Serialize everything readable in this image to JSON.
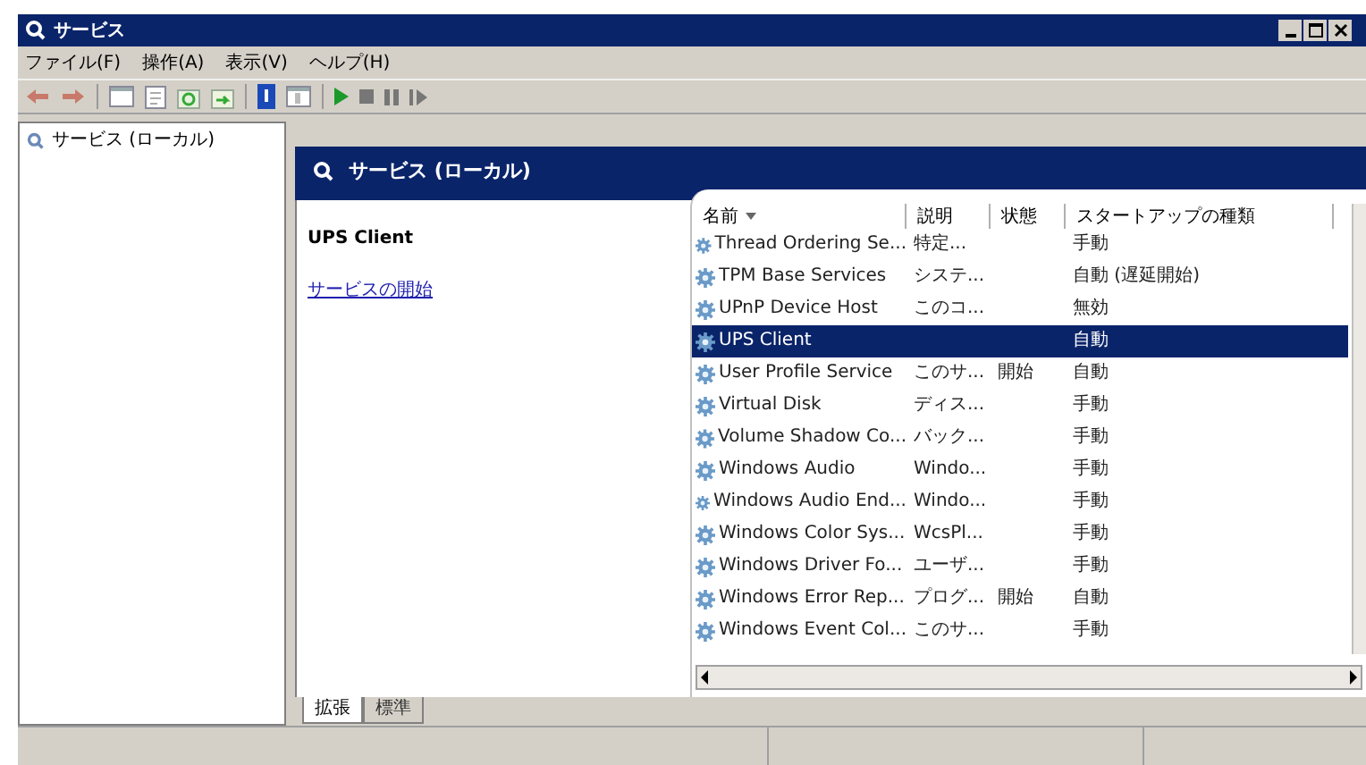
{
  "window": {
    "title": "サービス"
  },
  "menu": [
    "ファイル(F)",
    "操作(A)",
    "表示(V)",
    "ヘルプ(H)"
  ],
  "tree": {
    "items": [
      {
        "label": "サービス (ローカル)",
        "selected": false
      }
    ]
  },
  "panel": {
    "header": "サービス (ローカル)",
    "service_name": "UPS Client",
    "link": "サービスの開始"
  },
  "table": {
    "columns": [
      "名前",
      "説明",
      "状態",
      "スタートアップの種類"
    ],
    "rows": [
      {
        "name": "Thread Ordering Se...",
        "description": "特定...",
        "status": "",
        "startup": "手動",
        "selected": false
      },
      {
        "name": "TPM Base Services",
        "description": "システ...",
        "status": "",
        "startup": "自動 (遅延開始)",
        "selected": false
      },
      {
        "name": "UPnP Device Host",
        "description": "このコ...",
        "status": "",
        "startup": "無効",
        "selected": false
      },
      {
        "name": "UPS Client",
        "description": "",
        "status": "",
        "startup": "自動",
        "selected": true
      },
      {
        "name": "User Profile Service",
        "description": "このサ...",
        "status": "開始",
        "startup": "自動",
        "selected": false
      },
      {
        "name": "Virtual Disk",
        "description": "ディス...",
        "status": "",
        "startup": "手動",
        "selected": false
      },
      {
        "name": "Volume Shadow Co...",
        "description": "バック...",
        "status": "",
        "startup": "手動",
        "selected": false
      },
      {
        "name": "Windows Audio",
        "description": "Windo...",
        "status": "",
        "startup": "手動",
        "selected": false
      },
      {
        "name": "Windows Audio End...",
        "description": "Windo...",
        "status": "",
        "startup": "手動",
        "selected": false
      },
      {
        "name": "Windows Color Sys...",
        "description": "WcsPl...",
        "status": "",
        "startup": "手動",
        "selected": false
      },
      {
        "name": "Windows Driver Fo...",
        "description": "ユーザ...",
        "status": "",
        "startup": "手動",
        "selected": false
      },
      {
        "name": "Windows Error Rep...",
        "description": "プログ...",
        "status": "開始",
        "startup": "自動",
        "selected": false
      },
      {
        "name": "Windows Event Col...",
        "description": "このサ...",
        "status": "",
        "startup": "手動",
        "selected": false
      }
    ]
  },
  "tabs": [
    {
      "label": "拡張",
      "selected": true
    },
    {
      "label": "標準",
      "selected": false
    }
  ]
}
